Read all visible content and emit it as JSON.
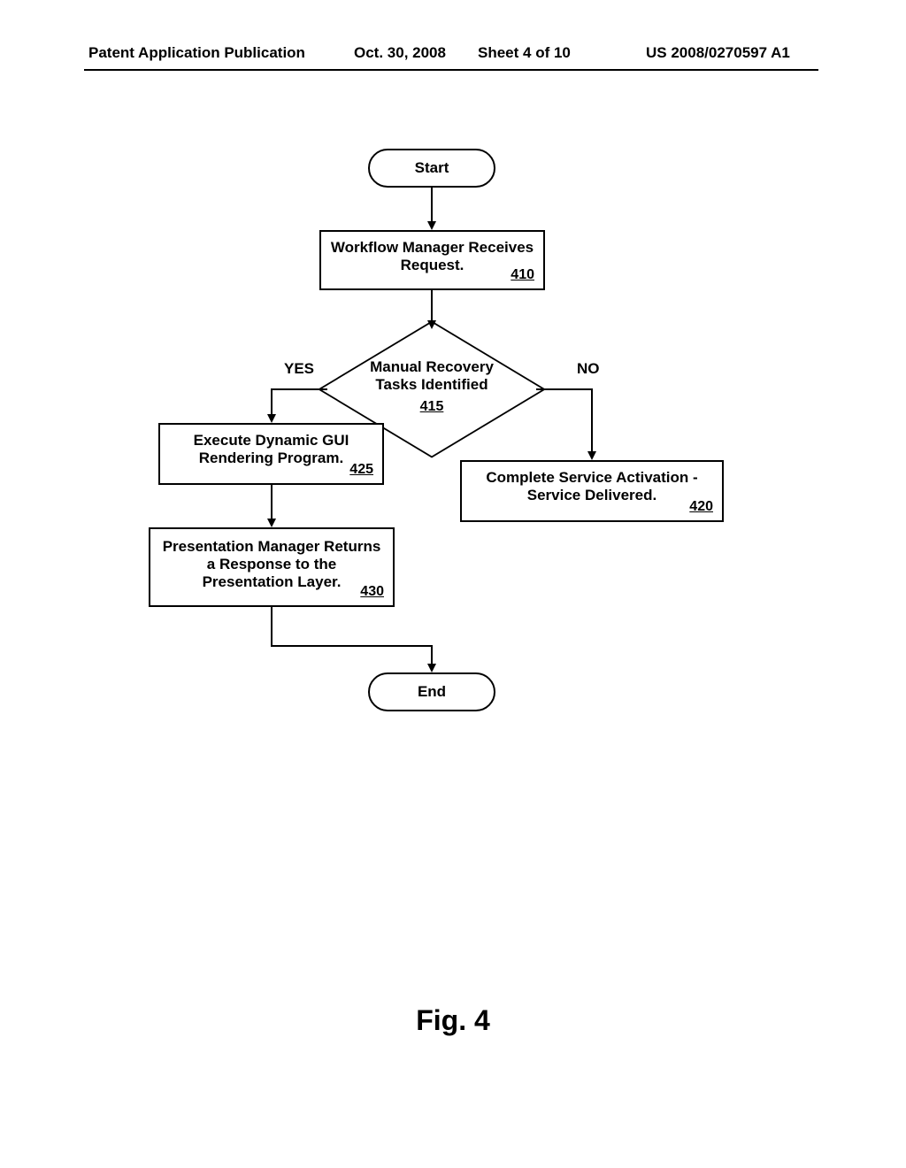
{
  "header": {
    "publication": "Patent Application Publication",
    "date": "Oct. 30, 2008",
    "sheet": "Sheet 4 of 10",
    "number": "US 2008/0270597 A1"
  },
  "nodes": {
    "start": "Start",
    "end": "End",
    "step410": {
      "text": "Workflow Manager Receives Request.",
      "ref": "410"
    },
    "decision415": {
      "text": "Manual Recovery Tasks Identified",
      "ref": "415"
    },
    "step420": {
      "text": "Complete Service Activation - Service Delivered.",
      "ref": "420"
    },
    "step425": {
      "text": "Execute Dynamic GUI Rendering Program.",
      "ref": "425"
    },
    "step430": {
      "text": "Presentation Manager Returns a Response to the Presentation Layer.",
      "ref": "430"
    }
  },
  "edges": {
    "yes": "YES",
    "no": "NO"
  },
  "figure": "Fig. 4"
}
